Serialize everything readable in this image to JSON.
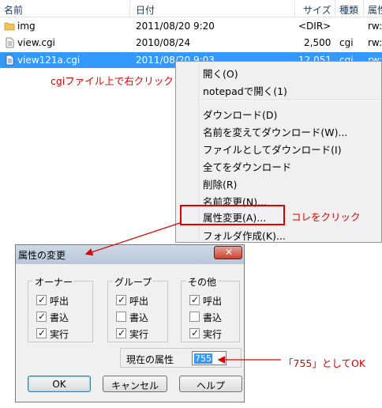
{
  "file_list": {
    "columns": [
      "名前",
      "日付",
      "サイズ",
      "種類",
      "属性"
    ],
    "rows": [
      {
        "name": "img",
        "icon": "folder-icon",
        "date": "2011/08/20  9:20",
        "size": "<DIR>",
        "type": "",
        "attr": "rw:"
      },
      {
        "name": "view.cgi",
        "icon": "file-icon",
        "date": "2010/08/24",
        "size": "2,500",
        "type": "cgi",
        "attr": "rw:"
      },
      {
        "name": "view121a.cgi",
        "icon": "file-icon",
        "date": "2011/08/20  9:03",
        "size": "12,051",
        "type": "cgi",
        "attr": "rw:"
      }
    ]
  },
  "annotations": {
    "right_click_note": "cgiファイル上で右クリック",
    "click_this": "コレをクリック",
    "value_note": "「755」としてOK"
  },
  "context_menu": {
    "items": [
      "開く(O)",
      "notepadで開く(1)",
      "ダウンロード(D)",
      "名前を変えてダウンロード(W)...",
      "ファイルとしてダウンロード(I)",
      "全てをダウンロード",
      "削除(R)",
      "名前変更(N)...",
      "属性変更(A)...",
      "フォルダ作成(K)..."
    ]
  },
  "dialog": {
    "title": "属性の変更",
    "groups": [
      {
        "label": "オーナー",
        "options": [
          {
            "label": "呼出",
            "checked": true
          },
          {
            "label": "書込",
            "checked": true
          },
          {
            "label": "実行",
            "checked": true
          }
        ]
      },
      {
        "label": "グループ",
        "options": [
          {
            "label": "呼出",
            "checked": true
          },
          {
            "label": "書込",
            "checked": false
          },
          {
            "label": "実行",
            "checked": true
          }
        ]
      },
      {
        "label": "その他",
        "options": [
          {
            "label": "呼出",
            "checked": true
          },
          {
            "label": "書込",
            "checked": false
          },
          {
            "label": "実行",
            "checked": true
          }
        ]
      }
    ],
    "current_attr_label": "現在の属性",
    "current_attr_value": "755",
    "buttons": {
      "ok": "OK",
      "cancel": "キャンセル",
      "help": "ヘルプ"
    }
  },
  "colors": {
    "selection": "#3399ff",
    "annotation": "#e00000"
  }
}
